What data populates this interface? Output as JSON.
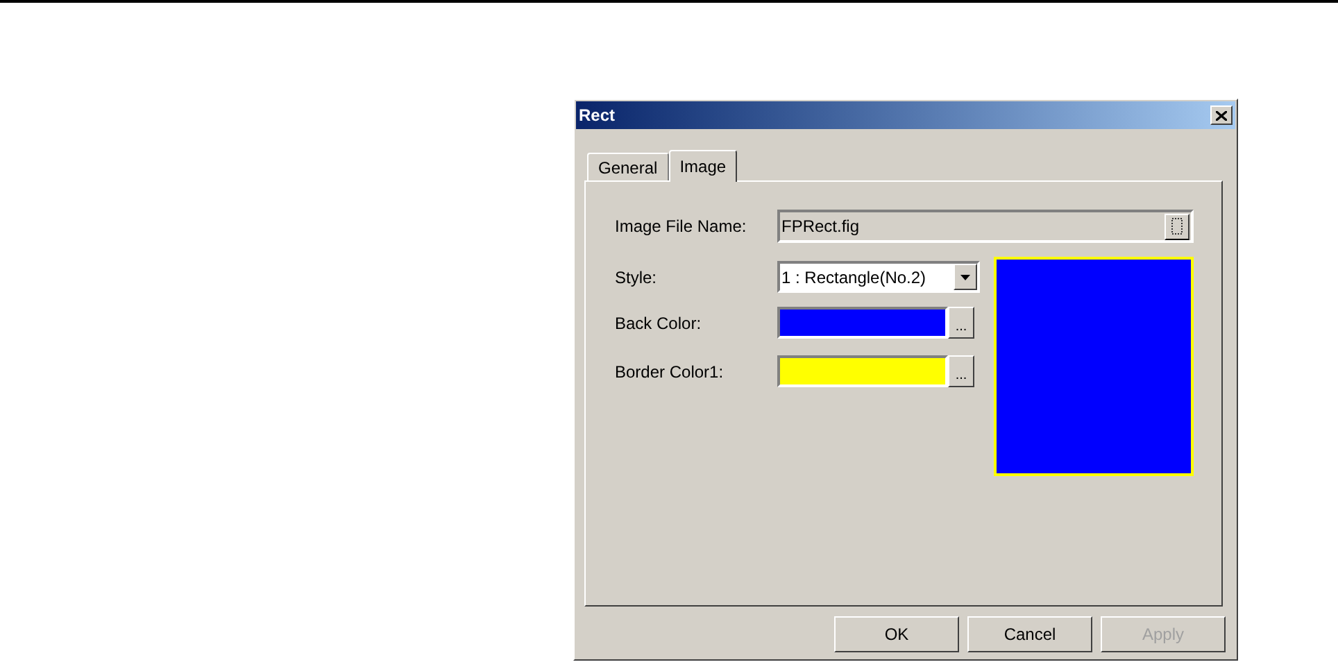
{
  "window": {
    "title": "Rect"
  },
  "tabs": [
    {
      "label": "General",
      "selected": false
    },
    {
      "label": "Image",
      "selected": true
    }
  ],
  "image_file_name": {
    "label": "Image File Name:",
    "value": "FPRect.fig"
  },
  "style": {
    "label": "Style:",
    "value": "1 : Rectangle(No.2)"
  },
  "colors": [
    {
      "label": "Back Color:",
      "color": "#0000ff",
      "button": "..."
    },
    {
      "label": "Border Color1:",
      "color": "#ffff00",
      "button": "..."
    }
  ],
  "buttons": [
    {
      "label": "OK",
      "disabled": false
    },
    {
      "label": "Cancel",
      "disabled": false
    },
    {
      "label": "Apply",
      "disabled": true
    }
  ]
}
